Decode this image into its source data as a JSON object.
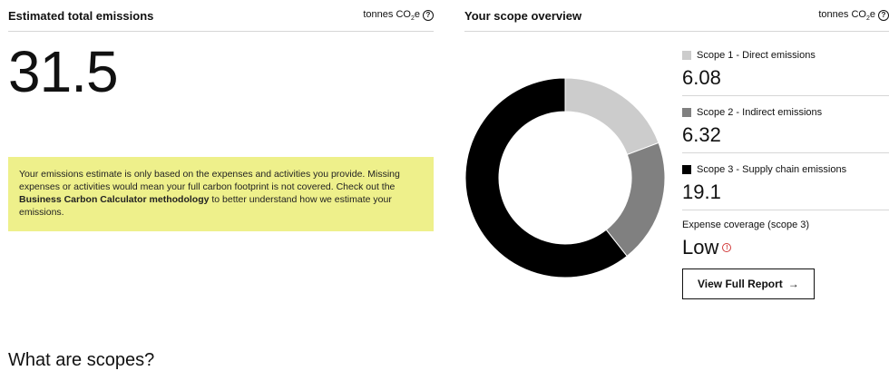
{
  "left_panel": {
    "title": "Estimated total emissions",
    "unit_prefix": "tonnes CO",
    "unit_sub": "2",
    "unit_suffix": "e",
    "total": "31.5",
    "notice_text_1": "Your emissions estimate is only based on the expenses and activities you provide. Missing expenses or activities would mean your full carbon footprint is not covered. Check out the ",
    "notice_link": "Business Carbon Calculator methodology",
    "notice_text_2": " to better understand how we estimate your emissions."
  },
  "right_panel": {
    "title": "Your scope overview",
    "unit_prefix": "tonnes CO",
    "unit_sub": "2",
    "unit_suffix": "e",
    "scopes": [
      {
        "label": "Scope 1 - Direct emissions",
        "value": "6.08",
        "color": "#cccccc"
      },
      {
        "label": "Scope 2 - Indirect emissions",
        "value": "6.32",
        "color": "#808080"
      },
      {
        "label": "Scope 3 - Supply chain emissions",
        "value": "19.1",
        "color": "#000000"
      }
    ],
    "coverage_label": "Expense coverage (scope 3)",
    "coverage_value": "Low",
    "report_button": "View Full Report",
    "report_arrow": "→"
  },
  "donut_data": {
    "type": "pie",
    "values": [
      6.08,
      6.32,
      19.1
    ],
    "colors": [
      "#cccccc",
      "#808080",
      "#000000"
    ]
  },
  "scopes_heading": "What are scopes?"
}
